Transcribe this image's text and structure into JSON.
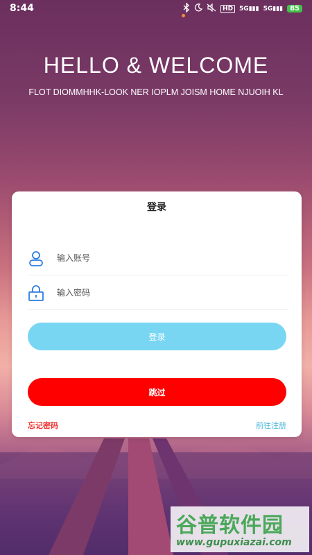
{
  "status": {
    "time": "8:44",
    "hd": "HD",
    "net1": "5G",
    "net2": "5G",
    "battery": "85"
  },
  "header": {
    "title": "HELLO & WELCOME",
    "subtitle": "FLOT DIOMMHHK-LOOK NER IOPLM JOISM HOME NJUOIH KL"
  },
  "login_card": {
    "title": "登录",
    "account_placeholder": "输入账号",
    "password_placeholder": "输入密码",
    "login_button": "登录",
    "skip_button": "跳过",
    "forgot_password": "忘记密码",
    "register": "前往注册"
  },
  "watermark": {
    "brand": "谷普软件园",
    "url": "www.gupuxiazai.com"
  },
  "colors": {
    "login_button": "#78d6f2",
    "skip_button": "#ff0000",
    "forgot_text": "#ee3333",
    "register_text": "#47b6d8",
    "icon_blue": "#2f7de1"
  }
}
